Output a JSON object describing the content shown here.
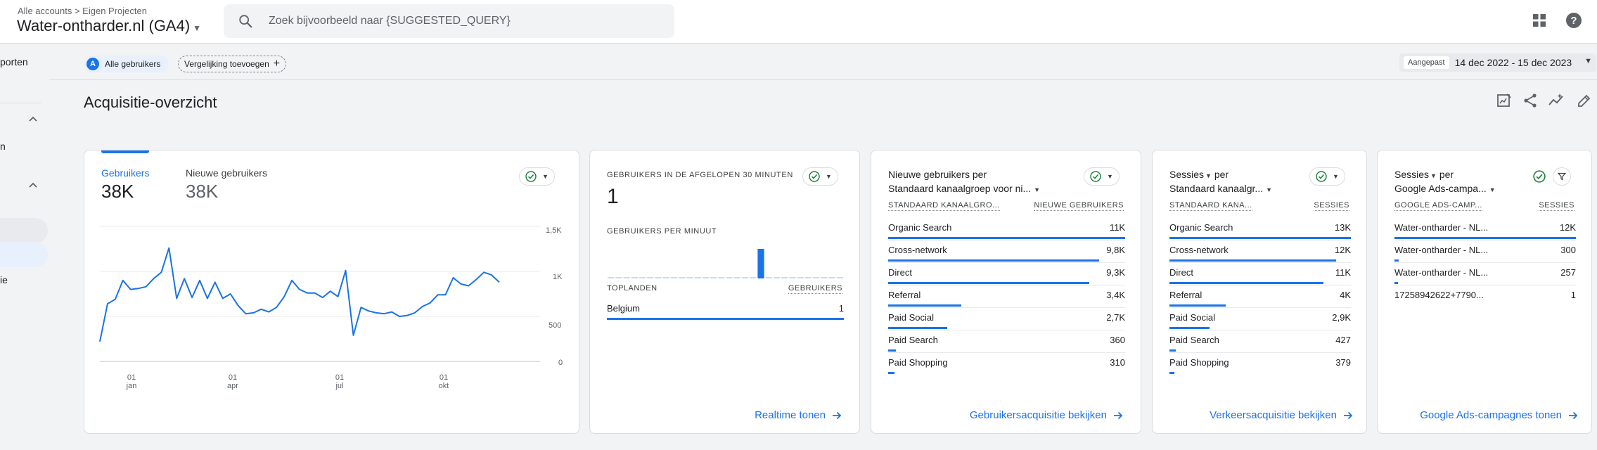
{
  "header": {
    "breadcrumb": [
      "Alle accounts",
      "Eigen Projecten"
    ],
    "property_name": "Water-ontharder.nl (GA4)",
    "search_placeholder": "Zoek bijvoorbeeld naar {SUGGESTED_QUERY}"
  },
  "leftnav": {
    "items": [
      "porten",
      "n",
      "ie"
    ]
  },
  "filters": {
    "segment_letter": "A",
    "segment_label": "Alle gebruikers",
    "compare_label": "Vergelijking toevoegen",
    "date_tag": "Aangepast",
    "date_range": "14 dec 2022 - 15 dec 2023"
  },
  "page": {
    "title": "Acquisitie-overzicht"
  },
  "colors": {
    "accent": "#1a73e8",
    "success": "#188038"
  },
  "card_users": {
    "tabs": [
      {
        "label": "Gebruikers",
        "value": "38K"
      },
      {
        "label": "Nieuwe gebruikers",
        "value": "38K"
      }
    ],
    "y_ticks": [
      "1,5K",
      "1K",
      "500",
      "0"
    ],
    "x_ticks": [
      {
        "day": "01",
        "month": "jan"
      },
      {
        "day": "01",
        "month": "apr"
      },
      {
        "day": "01",
        "month": "jul"
      },
      {
        "day": "01",
        "month": "okt"
      }
    ]
  },
  "chart_data": {
    "type": "line",
    "series": [
      {
        "name": "Gebruikers",
        "values": [
          220,
          640,
          690,
          900,
          800,
          810,
          830,
          920,
          990,
          1260,
          700,
          920,
          710,
          900,
          700,
          880,
          700,
          750,
          620,
          530,
          540,
          580,
          550,
          600,
          720,
          900,
          800,
          760,
          760,
          710,
          780,
          720,
          1010,
          290,
          600,
          560,
          540,
          530,
          550,
          500,
          510,
          540,
          610,
          650,
          740,
          740,
          930,
          860,
          840,
          910,
          990,
          960,
          880
        ]
      }
    ],
    "x_start": "2022-12-14",
    "x_end": "2023-12-15",
    "x_tick_labels": [
      "01 jan",
      "01 apr",
      "01 jul",
      "01 okt"
    ],
    "ylim": [
      0,
      1500
    ],
    "y_tick_labels": [
      "0",
      "500",
      "1K",
      "1,5K"
    ],
    "grid": true
  },
  "card_realtime": {
    "title": "GEBRUIKERS IN DE AFGELOPEN 30 MINUTEN",
    "value": "1",
    "sub_title": "GEBRUIKERS PER MINUUT",
    "per_minute": [
      0,
      0,
      0,
      0,
      0,
      0,
      0,
      0,
      0,
      0,
      0,
      0,
      0,
      0,
      0,
      0,
      0,
      0,
      0,
      1,
      0,
      0,
      0,
      0,
      0,
      0,
      0,
      0,
      0,
      0
    ],
    "table_head": [
      "TOPLANDEN",
      "GEBRUIKERS"
    ],
    "rows": [
      {
        "label": "Belgium",
        "value": "1"
      }
    ],
    "cta": "Realtime tonen"
  },
  "card_new_users": {
    "title_line1": "Nieuwe gebruikers per",
    "title_line2": "Standaard kanaalgroep voor ni...",
    "col1": "STANDAARD KANAALGRO...",
    "col2": "NIEUWE GEBRUIKERS",
    "rows": [
      {
        "label": "Organic Search",
        "value": "11K",
        "frac": 1.0
      },
      {
        "label": "Cross-network",
        "value": "9,8K",
        "frac": 0.89
      },
      {
        "label": "Direct",
        "value": "9,3K",
        "frac": 0.85
      },
      {
        "label": "Referral",
        "value": "3,4K",
        "frac": 0.31
      },
      {
        "label": "Paid Social",
        "value": "2,7K",
        "frac": 0.25
      },
      {
        "label": "Paid Search",
        "value": "360",
        "frac": 0.033
      },
      {
        "label": "Paid Shopping",
        "value": "310",
        "frac": 0.028
      }
    ],
    "cta": "Gebruikersacquisitie bekijken"
  },
  "card_sessions": {
    "title_line1": "Sessies",
    "title_per": "per",
    "title_line2": "Standaard kanaalgr...",
    "col1": "STANDAARD KANA...",
    "col2": "SESSIES",
    "rows": [
      {
        "label": "Organic Search",
        "value": "13K",
        "frac": 1.0
      },
      {
        "label": "Cross-network",
        "value": "12K",
        "frac": 0.92
      },
      {
        "label": "Direct",
        "value": "11K",
        "frac": 0.85
      },
      {
        "label": "Referral",
        "value": "4K",
        "frac": 0.31
      },
      {
        "label": "Paid Social",
        "value": "2,9K",
        "frac": 0.22
      },
      {
        "label": "Paid Search",
        "value": "427",
        "frac": 0.033
      },
      {
        "label": "Paid Shopping",
        "value": "379",
        "frac": 0.029
      }
    ],
    "cta": "Verkeersacquisitie bekijken"
  },
  "card_ads": {
    "title_line1": "Sessies",
    "title_per": "per",
    "title_line2": "Google Ads-campa...",
    "col1": "GOOGLE ADS-CAMP...",
    "col2": "SESSIES",
    "rows": [
      {
        "label": "Water-ontharder - NL...",
        "value": "12K",
        "frac": 1.0
      },
      {
        "label": "Water-ontharder - NL...",
        "value": "300",
        "frac": 0.025
      },
      {
        "label": "Water-ontharder - NL...",
        "value": "257",
        "frac": 0.021
      },
      {
        "label": "17258942622+7790...",
        "value": "1",
        "frac": 0.0
      }
    ],
    "cta": "Google Ads-campagnes tonen"
  }
}
